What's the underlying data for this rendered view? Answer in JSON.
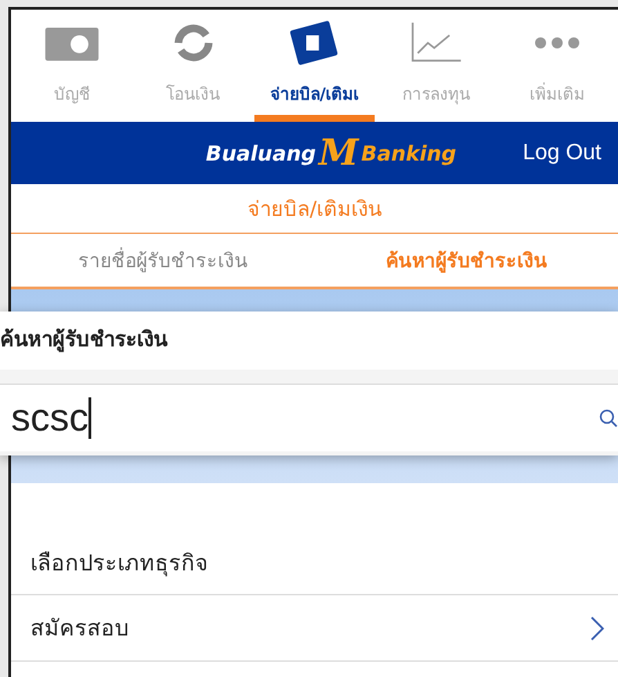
{
  "tab_bar": {
    "tabs": [
      {
        "label": "บัญชี",
        "selected": false
      },
      {
        "label": "โอนเงิน",
        "selected": false
      },
      {
        "label": "จ่ายบิล/เติมเ",
        "selected": true
      },
      {
        "label": "การลงทุน",
        "selected": false
      },
      {
        "label": "เพิ่มเติม",
        "selected": false
      }
    ]
  },
  "header": {
    "logo_left": "Bualuang",
    "logo_mark": "M",
    "logo_right": "Banking",
    "logout": "Log Out"
  },
  "page_title": "จ่ายบิล/เติมเงิน",
  "sub_tabs": [
    {
      "label": "รายชื่อผู้รับชำระเงิน",
      "selected": false
    },
    {
      "label": "ค้นหาผู้รับชำระเงิน",
      "selected": true
    }
  ],
  "search_callout": {
    "title": "ค้นหาผู้รับชำระเงิน",
    "value": "scsc"
  },
  "business_section": {
    "heading": "เลือกประเภทธุรกิจ",
    "items": [
      {
        "label": "สมัครสอบ"
      }
    ]
  }
}
